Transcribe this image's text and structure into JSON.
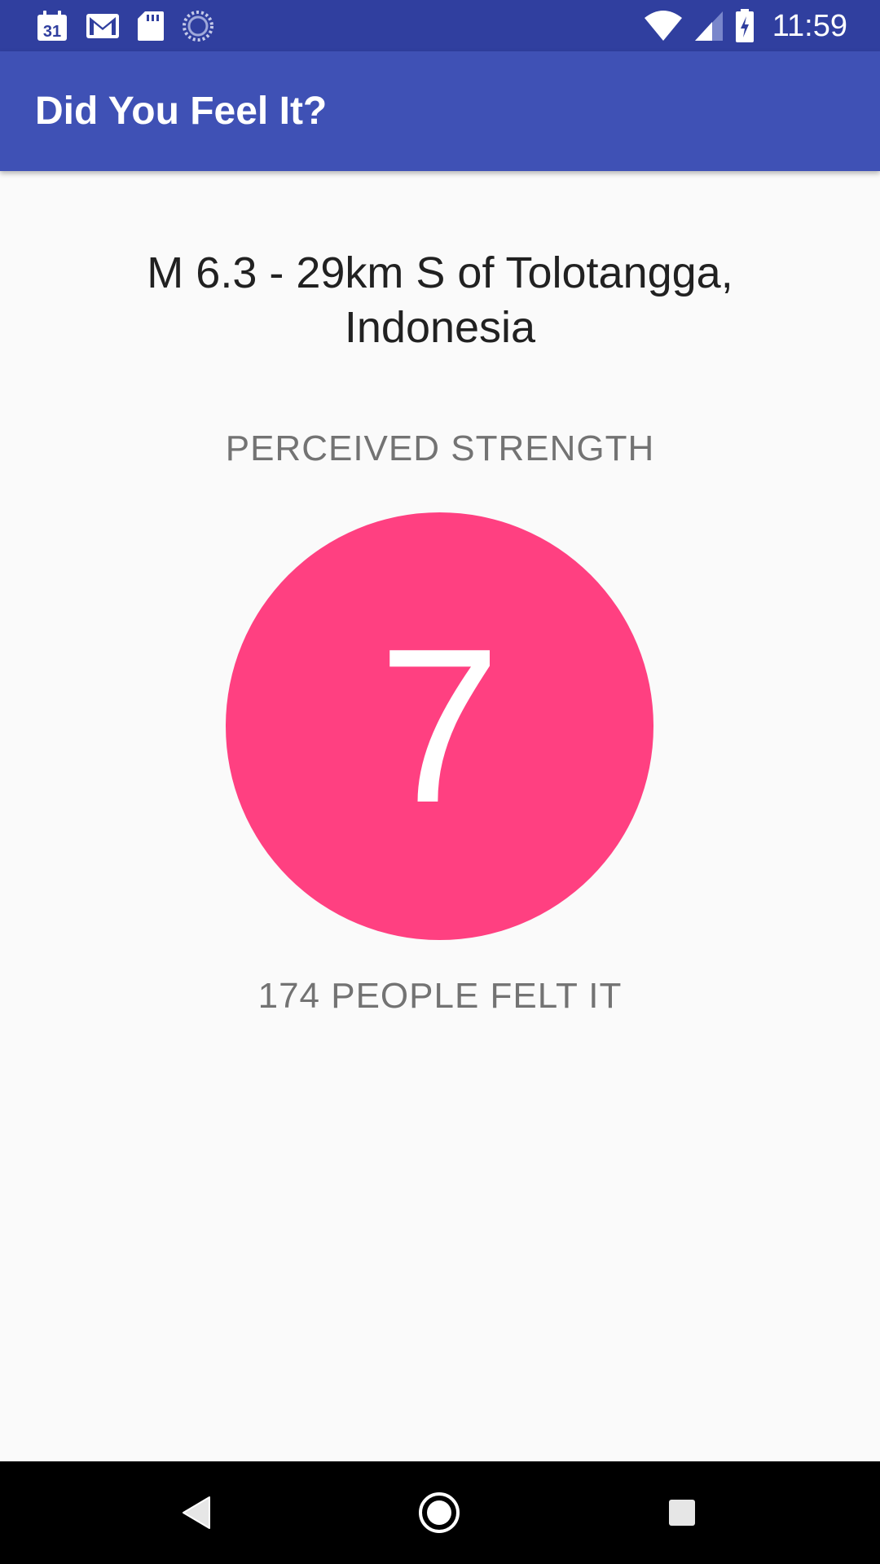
{
  "status_bar": {
    "time": "11:59",
    "calendar_day": "31",
    "icons": [
      "calendar-icon",
      "gmail-icon",
      "sd-card-icon",
      "sync-progress-icon",
      "wifi-icon",
      "cell-signal-icon",
      "battery-charging-icon"
    ]
  },
  "app_bar": {
    "title": "Did You Feel It?"
  },
  "earthquake": {
    "title": "M 6.3 - 29km S of Tolotangga, Indonesia",
    "perceived_strength_label": "PERCEIVED STRENGTH",
    "perceived_strength_value": "7",
    "felt_reports": "174 PEOPLE FELT IT"
  },
  "colors": {
    "status_bar": "#303f9f",
    "app_bar": "#3f51b5",
    "accent": "#ff4081",
    "background": "#fafafa"
  },
  "nav_bar": {
    "icons": [
      "back-icon",
      "home-icon",
      "recents-icon"
    ]
  }
}
